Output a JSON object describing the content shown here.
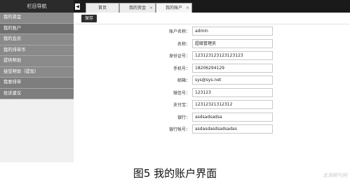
{
  "sidebar": {
    "title": "栏目导航",
    "items": [
      {
        "label": "我的资金"
      },
      {
        "label": "我的账户"
      },
      {
        "label": "我的会员"
      },
      {
        "label": "我的排单币"
      },
      {
        "label": "提供帮助"
      },
      {
        "label": "接受帮助（提现）"
      },
      {
        "label": "我要排单"
      },
      {
        "label": "投诉建议"
      }
    ]
  },
  "tabs": [
    {
      "label": "首页"
    },
    {
      "label": "我的资金"
    },
    {
      "label": "我的账户"
    }
  ],
  "toolbar": {
    "save_label": "保存"
  },
  "form": {
    "fields": [
      {
        "label": "账户名称：",
        "value": "admin"
      },
      {
        "label": "名称：",
        "value": "超级管理员"
      },
      {
        "label": "身份证号：",
        "value": "123123123123123123"
      },
      {
        "label": "手机号：",
        "value": "18206294129"
      },
      {
        "label": "邮箱：",
        "value": "sys@sys.net"
      },
      {
        "label": "微信号：",
        "value": "123123"
      },
      {
        "label": "支付宝：",
        "value": "12312321312312"
      },
      {
        "label": "银行：",
        "value": "asdsadsadsa"
      },
      {
        "label": "银行帐号：",
        "value": "asdasdasdsadsadas"
      }
    ]
  },
  "caption": "图5  我的账户界面",
  "watermark": "龙源期刊网",
  "icons": {
    "tab_scroll": "chevron-left-icon",
    "tab_close": "close-icon"
  }
}
